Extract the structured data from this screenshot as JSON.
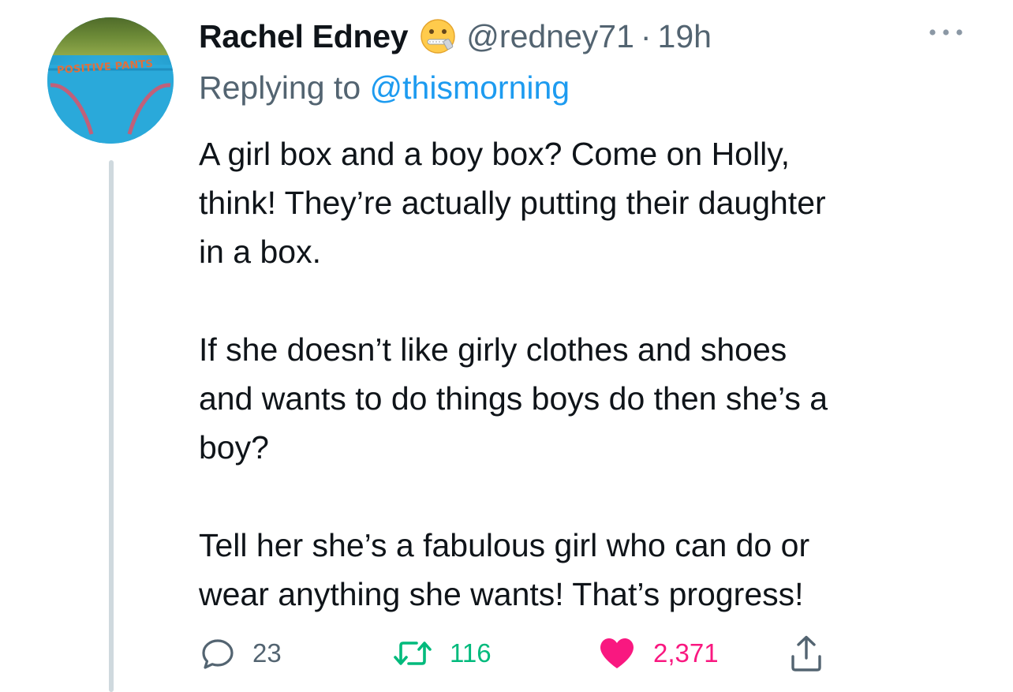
{
  "tweet": {
    "author": {
      "display_name": "Rachel Edney",
      "handle": "@redney71",
      "avatar_text": "POSITIVE PANTS",
      "emoji": "zipper-mouth-face-emoji"
    },
    "separator": "·",
    "time": "19h",
    "reply_prefix": "Replying to",
    "reply_to": "@thismorning",
    "paragraphs": [
      "A girl box and a boy box? Come on Holly,\nthink! They’re actually putting their daughter\nin a box.",
      "If she doesn’t like girly clothes and shoes\nand wants to do things boys do then she’s a\nboy?",
      "Tell her she’s a fabulous girl who can do or\nwear anything she wants! That’s progress!"
    ],
    "stats": {
      "replies": "23",
      "retweets": "116",
      "likes": "2,371"
    }
  },
  "icons": {
    "more": "more-horizontal-icon",
    "reply": "comment-bubble-icon",
    "retweet": "retweet-arrows-icon",
    "like": "heart-filled-icon",
    "share": "share-upload-icon"
  },
  "colors": {
    "text": "#0f1419",
    "secondary": "#536471",
    "link": "#1d9bf0",
    "retweet": "#00ba7c",
    "like": "#f91880",
    "thread_line": "#cfd9de"
  }
}
